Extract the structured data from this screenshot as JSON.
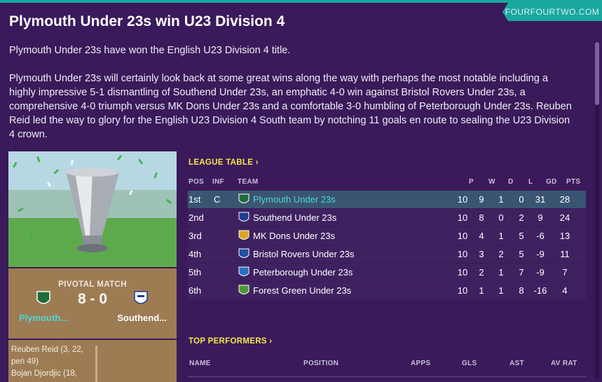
{
  "source": "FOURFOURTWO.COM",
  "headline": "Plymouth Under 23s win U23 Division 4",
  "body": {
    "p1": "Plymouth Under 23s have won the English U23 Division 4 title.",
    "p2": "Plymouth Under 23s will certainly look back at some great wins along the way with perhaps the most notable including a highly impressive 5-1 dismantling of Southend Under 23s, an emphatic 4-0 win against Bristol Rovers Under 23s, a comprehensive 4-0 triumph versus MK Dons Under 23s and a comfortable 3-0 humbling of Peterborough Under 23s. Reuben Reid led the way to glory for the English U23 Division 4 South team by notching 11 goals en route to sealing the U23 Division 4 crown."
  },
  "pivotal": {
    "label": "PIVOTAL MATCH",
    "score": "8 - 0",
    "home": "Plymouth...",
    "away": "Southend...",
    "scorers": "Reuben Reid (3, 22, pen 49)",
    "scorers2": "Bojan Djordjic (18,"
  },
  "league": {
    "title": "LEAGUE TABLE",
    "headers": {
      "pos": "POS",
      "inf": "INF",
      "team": "TEAM",
      "p": "P",
      "w": "W",
      "d": "D",
      "l": "L",
      "gd": "GD",
      "pts": "PTS"
    },
    "rows": [
      {
        "pos": "1st",
        "inf": "C",
        "team": "Plymouth Under 23s",
        "p": "10",
        "w": "9",
        "d": "1",
        "l": "0",
        "gd": "31",
        "pts": "28",
        "color": "#1e6b3a"
      },
      {
        "pos": "2nd",
        "inf": "",
        "team": "Southend Under 23s",
        "p": "10",
        "w": "8",
        "d": "0",
        "l": "2",
        "gd": "9",
        "pts": "24",
        "color": "#1c3f8f"
      },
      {
        "pos": "3rd",
        "inf": "",
        "team": "MK Dons Under 23s",
        "p": "10",
        "w": "4",
        "d": "1",
        "l": "5",
        "gd": "-6",
        "pts": "13",
        "color": "#d9a520"
      },
      {
        "pos": "4th",
        "inf": "",
        "team": "Bristol Rovers Under 23s",
        "p": "10",
        "w": "3",
        "d": "2",
        "l": "5",
        "gd": "-9",
        "pts": "11",
        "color": "#1f4fa0"
      },
      {
        "pos": "5th",
        "inf": "",
        "team": "Peterborough Under 23s",
        "p": "10",
        "w": "2",
        "d": "1",
        "l": "7",
        "gd": "-9",
        "pts": "7",
        "color": "#2a6fc4"
      },
      {
        "pos": "6th",
        "inf": "",
        "team": "Forest Green Under 23s",
        "p": "10",
        "w": "1",
        "d": "1",
        "l": "8",
        "gd": "-16",
        "pts": "4",
        "color": "#4a9a3a"
      }
    ]
  },
  "performers": {
    "title": "TOP PERFORMERS",
    "headers": {
      "name": "NAME",
      "position": "POSITION",
      "apps": "APPS",
      "gls": "GLS",
      "ast": "AST",
      "avrat": "AV RAT"
    }
  },
  "colors": {
    "bg": "#3a1a5a",
    "accent": "#1aa7a0",
    "highlight": "#3a5572",
    "section_title": "#f5e54a",
    "pivotal_bg": "#9d7c54"
  }
}
